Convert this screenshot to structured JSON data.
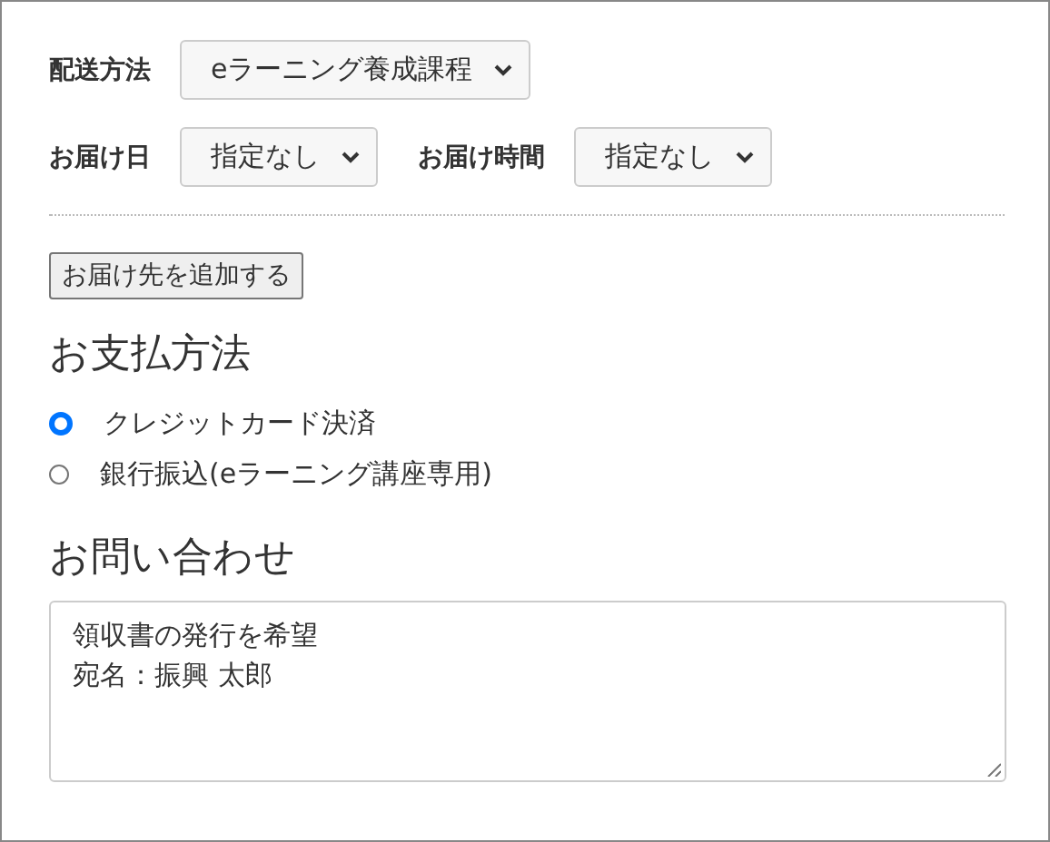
{
  "delivery": {
    "method": {
      "label": "配送方法",
      "value": "eラーニング養成課程"
    },
    "date": {
      "label": "お届け日",
      "value": "指定なし"
    },
    "time": {
      "label": "お届け時間",
      "value": "指定なし"
    }
  },
  "add_destination_button": "お届け先を追加する",
  "payment": {
    "heading": "お支払方法",
    "options": [
      {
        "label": "クレジットカード決済",
        "selected": true
      },
      {
        "label": "銀行振込(eラーニング講座専用)",
        "selected": false
      }
    ]
  },
  "inquiry": {
    "heading": "お問い合わせ",
    "lines": [
      "領収書の発行を希望",
      "宛名：振興 太郎"
    ]
  }
}
